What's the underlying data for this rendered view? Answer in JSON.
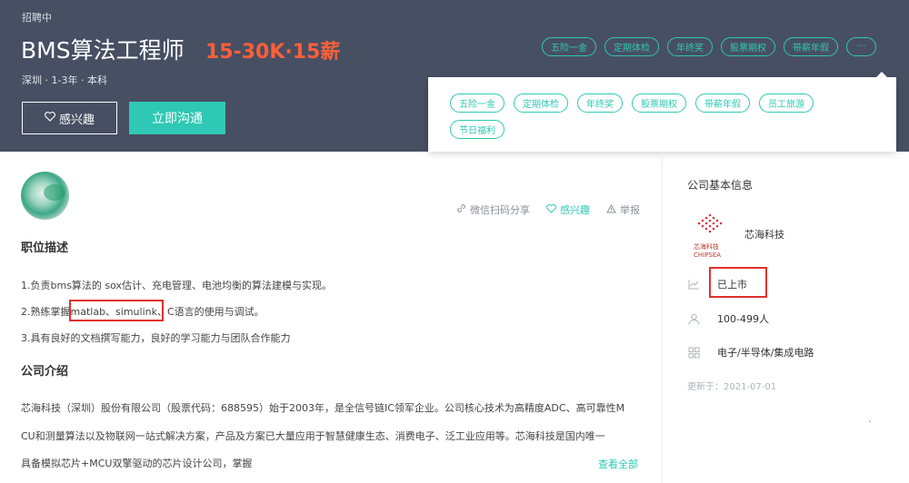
{
  "header": {
    "status": "招聘中",
    "title": "BMS算法工程师",
    "salary": "15-30K·15薪",
    "meta": "深圳 · 1-3年 · 本科",
    "interest_button": "感兴趣",
    "chat_button": "立即沟通",
    "tags": [
      "五险一金",
      "定期体检",
      "年终奖",
      "股票期权",
      "带薪年假"
    ],
    "more_tag": "···"
  },
  "popup": {
    "tags": [
      "五险一金",
      "定期体检",
      "年终奖",
      "股票期权",
      "带薪年假",
      "员工旅游",
      "节日福利"
    ]
  },
  "actions": {
    "share": "微信扫码分享",
    "interest": "感兴趣",
    "report": "举报"
  },
  "description": {
    "title": "职位描述",
    "lines": [
      "1.负责bms算法的 sox估计、充电管理、电池均衡的算法建模与实现。",
      "2.熟练掌握matlab、simulink、C语言的使用与调试。",
      "3.具有良好的文档撰写能力，良好的学习能力与团队合作能力"
    ]
  },
  "company_intro": {
    "title": "公司介绍",
    "lines": [
      "芯海科技（深圳）股份有限公司（股票代码：688595）始于2003年，是全信号链IC领军企业。公司核心技术为高精度ADC、高可靠性M",
      "CU和测量算法以及物联网一站式解决方案，产品及方案已大量应用于智慧健康生态、消费电子、泛工业应用等。芯海科技是国内唯一",
      "具备模拟芯片+MCU双擎驱动的芯片设计公司，掌握"
    ],
    "see_all": "查看全部"
  },
  "sidebar": {
    "title": "公司基本信息",
    "logo_text": "芯海科技",
    "logo_subtext": "CHIPSEA",
    "company": "芯海科技",
    "listing": "已上市",
    "size": "100-499人",
    "industry": "电子/半导体/集成电路",
    "updated": "更新于：2021-07-01"
  },
  "colors": {
    "banner": "#474f63",
    "accent": "#2fc8b4",
    "salary": "#fd5f39",
    "highlight": "#e0312b"
  }
}
